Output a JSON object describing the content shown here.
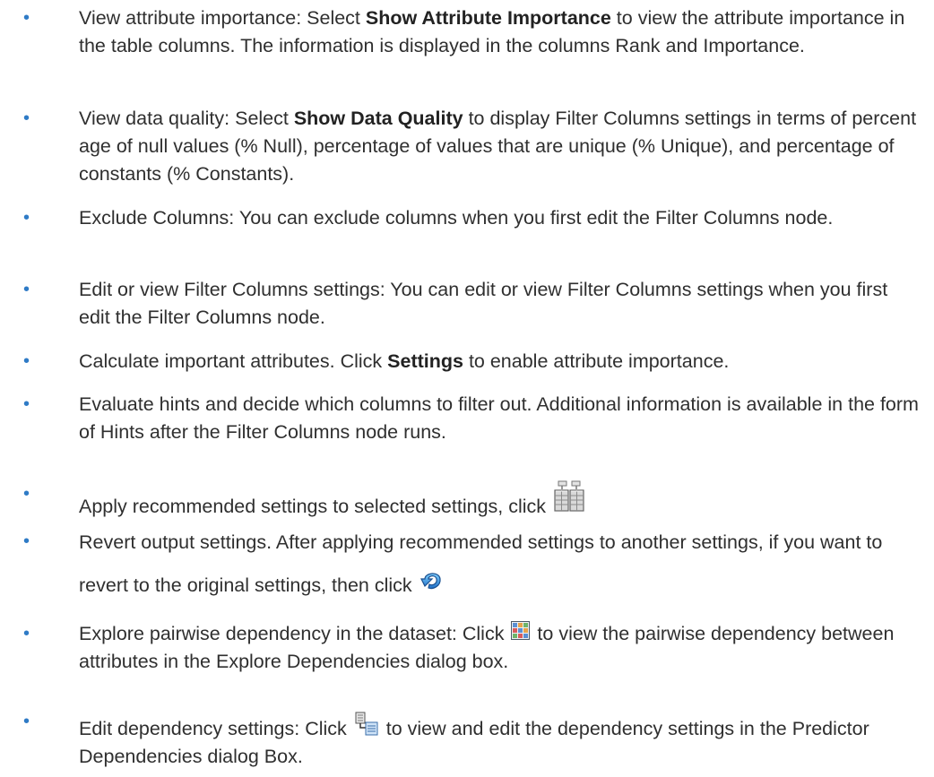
{
  "colors": {
    "bullet": "#2f7bc6",
    "text": "#2f2f2f"
  },
  "bullet_glyph": "•",
  "items": [
    {
      "pre": "View attribute importance: Select ",
      "bold": "Show Attribute Importance",
      "post": " to view the attribute importance in the table columns. The information is displayed in the columns Rank and Importance."
    },
    {
      "pre": "View data quality: Select ",
      "bold": "Show Data Quality",
      "post": " to display Filter Columns settings in terms of percent age of null values (% Null), percentage of values that are unique (% Unique), and percentage of constants (% Constants)."
    },
    {
      "text": "Exclude Columns: You can exclude columns when you first edit the Filter Columns node."
    },
    {
      "text": "Edit or view Filter Columns settings: You can edit or view Filter Columns settings when you first edit the Filter Columns node."
    },
    {
      "pre": "Calculate important attributes. Click ",
      "bold": "Settings",
      "post": " to enable attribute importance."
    },
    {
      "text": "Evaluate hints and decide which columns to filter out. Additional information is available in the form of Hints after the Filter Columns node runs."
    },
    {
      "pre": "Apply recommended settings to selected settings, click ",
      "icon": "apply-recommended-settings-icon"
    },
    {
      "pre": "Revert output settings. After applying recommended settings to another settings, if you want to revert to the original settings, then click ",
      "icon": "revert-settings-icon"
    },
    {
      "pre": "Explore pairwise dependency in the dataset: Click ",
      "icon": "explore-dependencies-icon",
      "post": " to view the pairwise dependency between attributes in the Explore Dependencies dialog box."
    },
    {
      "pre": "Edit dependency settings: Click ",
      "icon": "edit-dependency-settings-icon",
      "post": " to view and edit the dependency settings in the Predictor Dependencies dialog Box."
    }
  ]
}
